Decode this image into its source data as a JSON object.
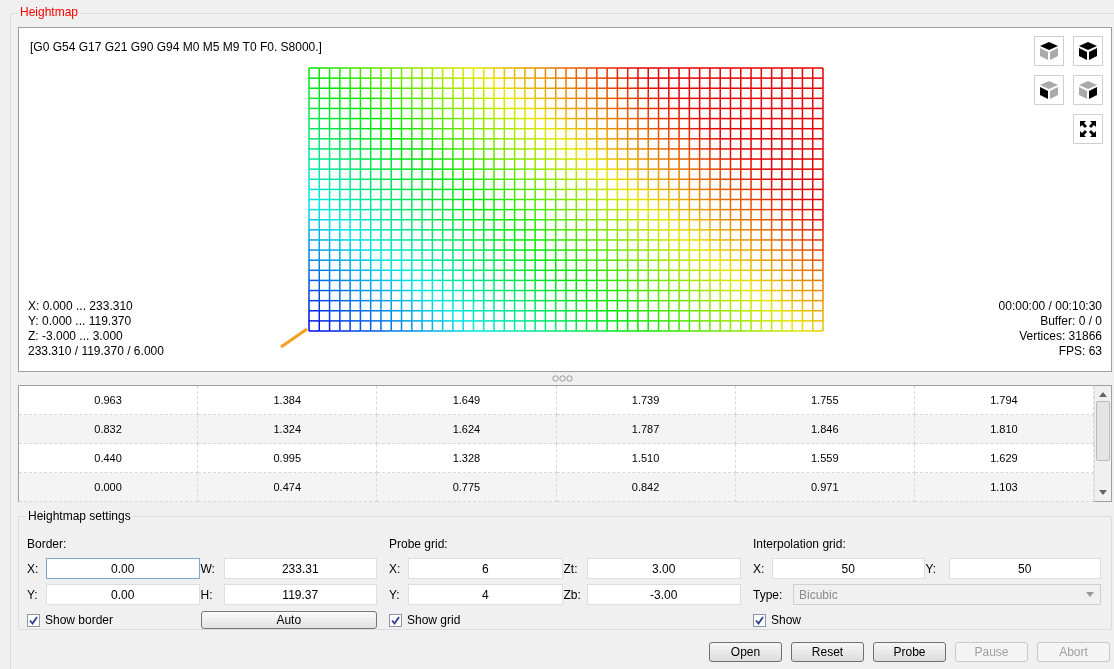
{
  "panel": {
    "title": "Heightmap"
  },
  "viewer": {
    "parser_state": "[G0 G54 G17 G21 G90 G94 M0 M5 M9 T0 F0. S8000.]",
    "ranges": [
      "X: 0.000 ... 233.310",
      "Y: 0.000 ... 119.370",
      "Z: -3.000 ... 3.000",
      "233.310 / 119.370 / 6.000"
    ],
    "status": [
      "00:00:00 / 00:10:30",
      "Buffer: 0 / 0",
      "Vertices: 31866",
      "FPS: 63"
    ]
  },
  "table": {
    "rows": [
      [
        "0.963",
        "1.384",
        "1.649",
        "1.739",
        "1.755",
        "1.794"
      ],
      [
        "0.832",
        "1.324",
        "1.624",
        "1.787",
        "1.846",
        "1.810"
      ],
      [
        "0.440",
        "0.995",
        "1.328",
        "1.510",
        "1.559",
        "1.629"
      ],
      [
        "0.000",
        "0.474",
        "0.775",
        "0.842",
        "0.971",
        "1.103"
      ]
    ]
  },
  "settings": {
    "title": "Heightmap settings",
    "sections": [
      {
        "title": "Border:",
        "fields": [
          {
            "label": "X:",
            "value": "0.00",
            "focused": true
          },
          {
            "label": "W:",
            "value": "233.31",
            "focused": false
          },
          {
            "label": "Y:",
            "value": "0.00",
            "focused": false
          },
          {
            "label": "H:",
            "value": "119.37",
            "focused": false
          }
        ],
        "checkbox": {
          "label": "Show border",
          "checked": true
        },
        "button": {
          "label": "Auto"
        }
      },
      {
        "title": "Probe grid:",
        "fields": [
          {
            "label": "X:",
            "value": "6",
            "focused": false
          },
          {
            "label": "Zt:",
            "value": "3.00",
            "focused": false
          },
          {
            "label": "Y:",
            "value": "4",
            "focused": false
          },
          {
            "label": "Zb:",
            "value": "-3.00",
            "focused": false
          }
        ],
        "checkbox": {
          "label": "Show grid",
          "checked": true
        }
      },
      {
        "title": "Interpolation grid:",
        "fields": [
          {
            "label": "X:",
            "value": "50",
            "focused": false
          },
          {
            "label": "Y:",
            "value": "50",
            "focused": false
          }
        ],
        "type": {
          "label": "Type:",
          "value": "Bicubic",
          "disabled": true
        },
        "checkbox": {
          "label": "Show",
          "checked": true
        }
      }
    ]
  },
  "buttons": [
    {
      "label": "Open",
      "disabled": false
    },
    {
      "label": "Reset",
      "disabled": false
    },
    {
      "label": "Probe",
      "disabled": false
    },
    {
      "label": "Pause",
      "disabled": true
    },
    {
      "label": "Abort",
      "disabled": true
    }
  ]
}
